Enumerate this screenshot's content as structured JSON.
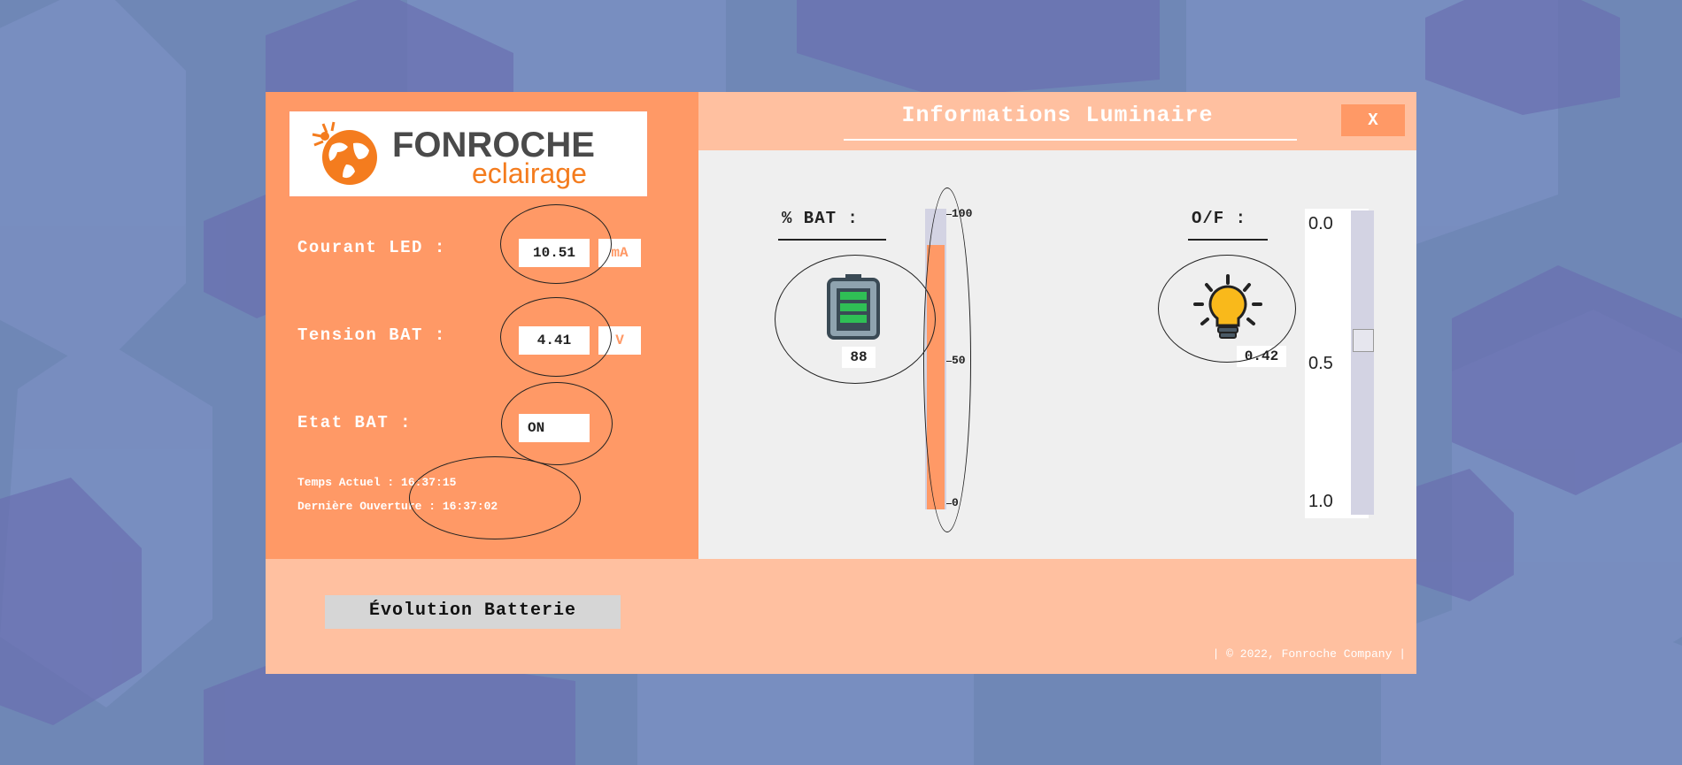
{
  "window": {
    "title": "Informations Luminaire",
    "close_label": "X"
  },
  "logo": {
    "line1": "FONROCHE",
    "line2": "eclairage"
  },
  "left": {
    "courant_label": "Courant LED :",
    "courant_value": "10.51",
    "courant_unit": "mA",
    "tension_label": "Tension BAT :",
    "tension_value": "4.41",
    "tension_unit": "V",
    "etat_label": "Etat BAT :",
    "etat_value": "ON",
    "temps_label": "Temps Actuel : 16:37:15",
    "ouverture_label": "Dernière Ouverture :  16:37:02"
  },
  "battery": {
    "section_label": "% BAT :",
    "value": "88",
    "level_percent": 88,
    "ticks": [
      "100",
      "50",
      "0"
    ],
    "fill_color": "#ff9966",
    "track_color": "#d3d3e3"
  },
  "lamp": {
    "section_label": "O/F :",
    "value": "0.42",
    "slider_value": 0.42,
    "scale": [
      "0.0",
      "0.5",
      "1.0"
    ]
  },
  "bottom": {
    "evolution_button": "Évolution Batterie",
    "copyright": "| © 2022, Fonroche Company |"
  },
  "colors": {
    "accent": "#ff9966",
    "light_accent": "#ffc0a0",
    "background": "#6f87b6"
  },
  "icons": [
    "globe-sun-icon",
    "battery-icon",
    "lightbulb-icon"
  ]
}
